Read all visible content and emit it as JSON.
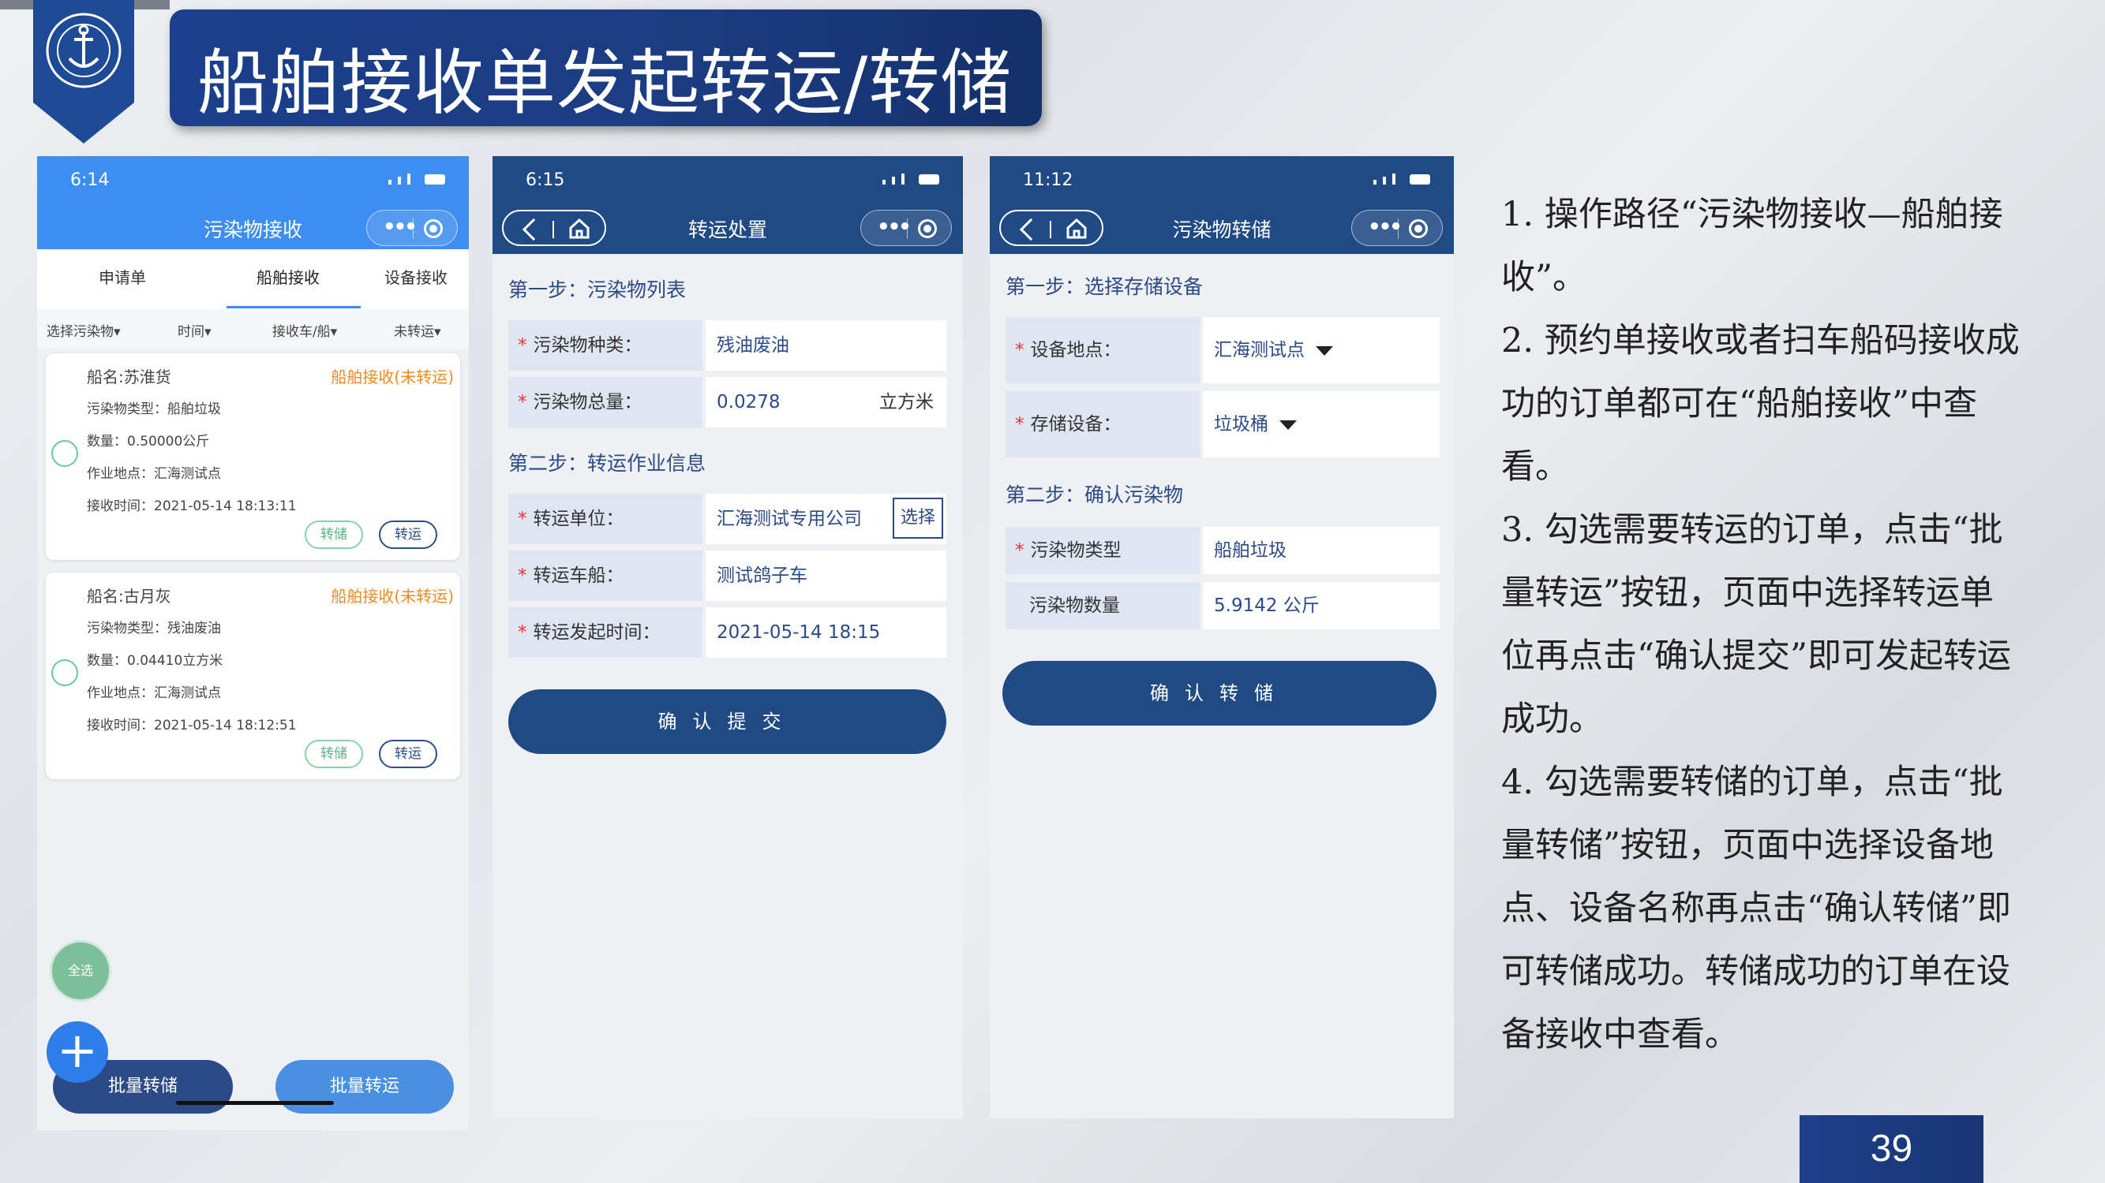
{
  "slide": {
    "title": "船舶接收单发起转运/转储",
    "page_number": "39"
  },
  "phone1": {
    "time": "6:14",
    "nav_title": "污染物接收",
    "tabs": [
      "申请单",
      "船舶接收",
      "设备接收"
    ],
    "filters": [
      "选择污染物▾",
      "时间▾",
      "接收车/船▾",
      "未转运▾"
    ],
    "cards": [
      {
        "ship": "船名:苏淮货",
        "status": "船舶接收(未转运)",
        "type": "污染物类型：船舶垃圾",
        "qty": "数量：0.50000公斤",
        "place": "作业地点：汇海测试点",
        "time": "接收时间：2021-05-14 18:13:11",
        "btn_store": "转储",
        "btn_transfer": "转运"
      },
      {
        "ship": "船名:古月灰",
        "status": "船舶接收(未转运)",
        "type": "污染物类型：残油废油",
        "qty": "数量：0.04410立方米",
        "place": "作业地点：汇海测试点",
        "time": "接收时间：2021-05-14 18:12:51",
        "btn_store": "转储",
        "btn_transfer": "转运"
      }
    ],
    "select_all": "全选",
    "plus": "+",
    "batch_store": "批量转储",
    "batch_transfer": "批量转运"
  },
  "phone2": {
    "time": "6:15",
    "nav_title": "转运处置",
    "step1": "第一步：污染物列表",
    "rows1": [
      {
        "label": "污染物种类：",
        "value": "残油废油"
      },
      {
        "label": "污染物总量：",
        "value": "0.0278",
        "unit": "立方米"
      }
    ],
    "step2": "第二步：转运作业信息",
    "rows2": [
      {
        "label": "转运单位：",
        "value": "汇海测试专用公司",
        "action": "选择"
      },
      {
        "label": "转运车船：",
        "value": "测试鸽子车"
      },
      {
        "label": "转运发起时间：",
        "value": "2021-05-14 18:15"
      }
    ],
    "confirm": "确认提交"
  },
  "phone3": {
    "time": "11:12",
    "nav_title": "污染物转储",
    "step1": "第一步：选择存储设备",
    "rows1": [
      {
        "label": "设备地点：",
        "value": "汇海测试点"
      },
      {
        "label": "存储设备：",
        "value": "垃圾桶"
      }
    ],
    "step2": "第二步：确认污染物",
    "rows2": [
      {
        "label": "污染物类型",
        "value": "船舶垃圾"
      },
      {
        "label": "污染物数量",
        "value": "5.9142 公斤"
      }
    ],
    "confirm": "确认转储"
  },
  "description": [
    "1. 操作路径“污染物接收—船舶接收”。",
    "2. 预约单接收或者扫车船码接收成功的订单都可在“船舶接收”中查看。",
    "3. 勾选需要转运的订单，点击“批量转运”按钮，页面中选择转运单位再点击“确认提交”即可发起转运成功。",
    "4. 勾选需要转储的订单，点击“批量转储”按钮，页面中选择设备地点、设备名称再点击“确认转储”即可转储成功。转储成功的订单在设备接收中查看。"
  ]
}
